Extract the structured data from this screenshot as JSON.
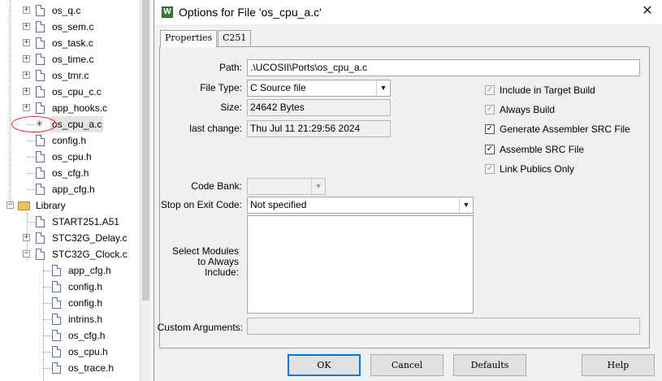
{
  "tree": {
    "items": [
      {
        "label": "os_q.c",
        "kind": "file",
        "expander": "+",
        "level": 1
      },
      {
        "label": "os_sem.c",
        "kind": "file",
        "expander": "+",
        "level": 1
      },
      {
        "label": "os_task.c",
        "kind": "file",
        "expander": "+",
        "level": 1
      },
      {
        "label": "os_time.c",
        "kind": "file",
        "expander": "+",
        "level": 1
      },
      {
        "label": "os_tmr.c",
        "kind": "file",
        "expander": "+",
        "level": 1
      },
      {
        "label": "os_cpu_c.c",
        "kind": "file",
        "expander": "+",
        "level": 1
      },
      {
        "label": "app_hooks.c",
        "kind": "file",
        "expander": "+",
        "level": 1
      },
      {
        "label": "os_cpu_a.c",
        "kind": "special",
        "expander": "",
        "level": 1,
        "selected": true
      },
      {
        "label": "config.h",
        "kind": "file",
        "expander": "",
        "level": 1
      },
      {
        "label": "os_cpu.h",
        "kind": "file",
        "expander": "",
        "level": 1
      },
      {
        "label": "os_cfg.h",
        "kind": "file",
        "expander": "",
        "level": 1
      },
      {
        "label": "app_cfg.h",
        "kind": "file",
        "expander": "",
        "level": 1
      },
      {
        "label": "Library",
        "kind": "folder",
        "expander": "−",
        "level": 0
      },
      {
        "label": "START251.A51",
        "kind": "file",
        "expander": "",
        "level": 1
      },
      {
        "label": "STC32G_Delay.c",
        "kind": "file",
        "expander": "+",
        "level": 1
      },
      {
        "label": "STC32G_Clock.c",
        "kind": "file",
        "expander": "−",
        "level": 1
      },
      {
        "label": "app_cfg.h",
        "kind": "file",
        "expander": "",
        "level": 2
      },
      {
        "label": "config.h",
        "kind": "file",
        "expander": "",
        "level": 2
      },
      {
        "label": "config.h",
        "kind": "file",
        "expander": "",
        "level": 2
      },
      {
        "label": "intrins.h",
        "kind": "file",
        "expander": "",
        "level": 2
      },
      {
        "label": "os_cfg.h",
        "kind": "file",
        "expander": "",
        "level": 2
      },
      {
        "label": "os_cpu.h",
        "kind": "file",
        "expander": "",
        "level": 2
      },
      {
        "label": "os_trace.h",
        "kind": "file",
        "expander": "",
        "level": 2
      }
    ]
  },
  "dialog": {
    "title": "Options for File 'os_cpu_a.c'",
    "close_glyph": "✕",
    "app_icon_glyph": "W",
    "tabs": [
      "Properties",
      "C251"
    ],
    "fields": {
      "path_label": "Path:",
      "path_value": ".\\UCOSII\\Ports\\os_cpu_a.c",
      "file_type_label": "File Type:",
      "file_type_value": "C Source file",
      "size_label": "Size:",
      "size_value": "24642 Bytes",
      "last_change_label": "last change:",
      "last_change_value": "Thu Jul 11 21:29:56 2024",
      "code_bank_label": "Code Bank:",
      "code_bank_value": "",
      "stop_label": "Stop on Exit Code:",
      "stop_value": "Not specified",
      "modules_label_1": "Select Modules",
      "modules_label_2": "to Always",
      "modules_label_3": "Include:",
      "custom_args_label": "Custom Arguments:",
      "custom_args_value": ""
    },
    "checkboxes": [
      {
        "label": "Include in Target Build",
        "checked": true,
        "enabled": false
      },
      {
        "label": "Always Build",
        "checked": true,
        "enabled": false
      },
      {
        "label": "Generate Assembler SRC File",
        "checked": true,
        "enabled": true
      },
      {
        "label": "Assemble SRC File",
        "checked": true,
        "enabled": true
      },
      {
        "label": "Link Publics Only",
        "checked": true,
        "enabled": false
      }
    ],
    "buttons": {
      "ok": "OK",
      "cancel": "Cancel",
      "defaults": "Defaults",
      "help": "Help"
    },
    "dropdown_arrow": "▼",
    "check_glyph": "✓"
  },
  "colors": {
    "annotation_circle": "#e02020",
    "dialog_bg": "#f0f0f0",
    "default_button_border": "#0078d7"
  }
}
